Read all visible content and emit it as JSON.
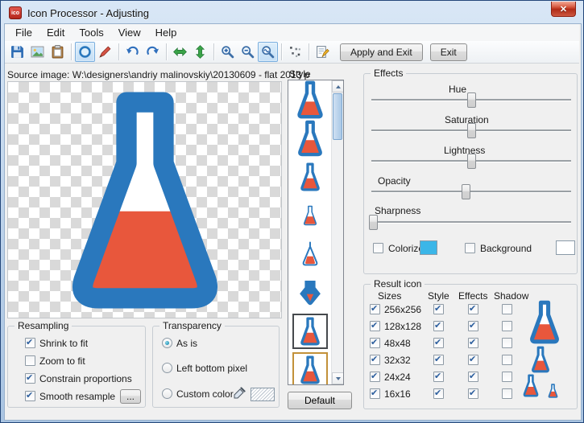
{
  "colors": {
    "flask_blue": "#2a78bd",
    "flask_orange": "#e8573c"
  },
  "window": {
    "title": "Icon Processor - Adjusting",
    "close_glyph": "✕",
    "app_icon_text": "ico"
  },
  "menu": {
    "items": [
      "File",
      "Edit",
      "Tools",
      "View",
      "Help"
    ]
  },
  "toolbar": {
    "icons": [
      "save",
      "export-image",
      "paste",
      "ellipse-select",
      "pencil",
      "undo",
      "redo",
      "stretch-horizontal",
      "stretch-vertical",
      "zoom-in",
      "zoom-out",
      "zoom-curve",
      "pixel-pattern",
      "adjust"
    ],
    "pressed": [
      "ellipse-select",
      "zoom-curve"
    ],
    "apply_exit_label": "Apply and Exit",
    "exit_label": "Exit"
  },
  "source": {
    "label": "Source image: W:\\designers\\andriy malinovskiy\\20130609 - flat 2013 p"
  },
  "style_panel": {
    "label": "Style",
    "default_button": "Default",
    "items": [
      "flask-flat",
      "flask-flat-alt",
      "flask-small",
      "flask-outline",
      "flask-kite",
      "flask-arrow",
      "flask-framed",
      "flask-framed-gold"
    ],
    "selected_index": 6
  },
  "effects": {
    "title": "Effects",
    "sliders": [
      {
        "label": "Hue",
        "thumb_left": "50%"
      },
      {
        "label": "Saturation",
        "thumb_left": "50%"
      },
      {
        "label": "Lightness",
        "thumb_left": "50%"
      },
      {
        "label": "Opacity",
        "thumb_left": "47%"
      },
      {
        "label": "Sharpness",
        "thumb_left": "1%"
      }
    ],
    "colorize_label": "Colorize",
    "colorize_checked": false,
    "colorize_color": "#3bb6e8",
    "background_label": "Background",
    "background_checked": false,
    "background_color": "#ffffff"
  },
  "result_icon": {
    "title": "Result icon",
    "columns": [
      "Sizes",
      "Style",
      "Effects",
      "Shadow"
    ],
    "rows": [
      {
        "size": "256x256",
        "sizes_checked": true,
        "style_checked": true,
        "effects_checked": true,
        "shadow_checked": false
      },
      {
        "size": "128x128",
        "sizes_checked": true,
        "style_checked": true,
        "effects_checked": true,
        "shadow_checked": false
      },
      {
        "size": "48x48",
        "sizes_checked": true,
        "style_checked": true,
        "effects_checked": true,
        "shadow_checked": false
      },
      {
        "size": "32x32",
        "sizes_checked": true,
        "style_checked": true,
        "effects_checked": true,
        "shadow_checked": false
      },
      {
        "size": "24x24",
        "sizes_checked": true,
        "style_checked": true,
        "effects_checked": true,
        "shadow_checked": false
      },
      {
        "size": "16x16",
        "sizes_checked": true,
        "style_checked": true,
        "effects_checked": true,
        "shadow_checked": false
      }
    ]
  },
  "resampling": {
    "title": "Resampling",
    "items": [
      {
        "label": "Shrink to fit",
        "checked": true
      },
      {
        "label": "Zoom to fit",
        "checked": false
      },
      {
        "label": "Constrain proportions",
        "checked": true
      },
      {
        "label": "Smooth resample",
        "checked": true
      }
    ],
    "more_button": "..."
  },
  "transparency": {
    "title": "Transparency",
    "options": [
      {
        "label": "As is",
        "selected": true
      },
      {
        "label": "Left bottom pixel",
        "selected": false
      },
      {
        "label": "Custom color",
        "selected": false
      }
    ]
  }
}
